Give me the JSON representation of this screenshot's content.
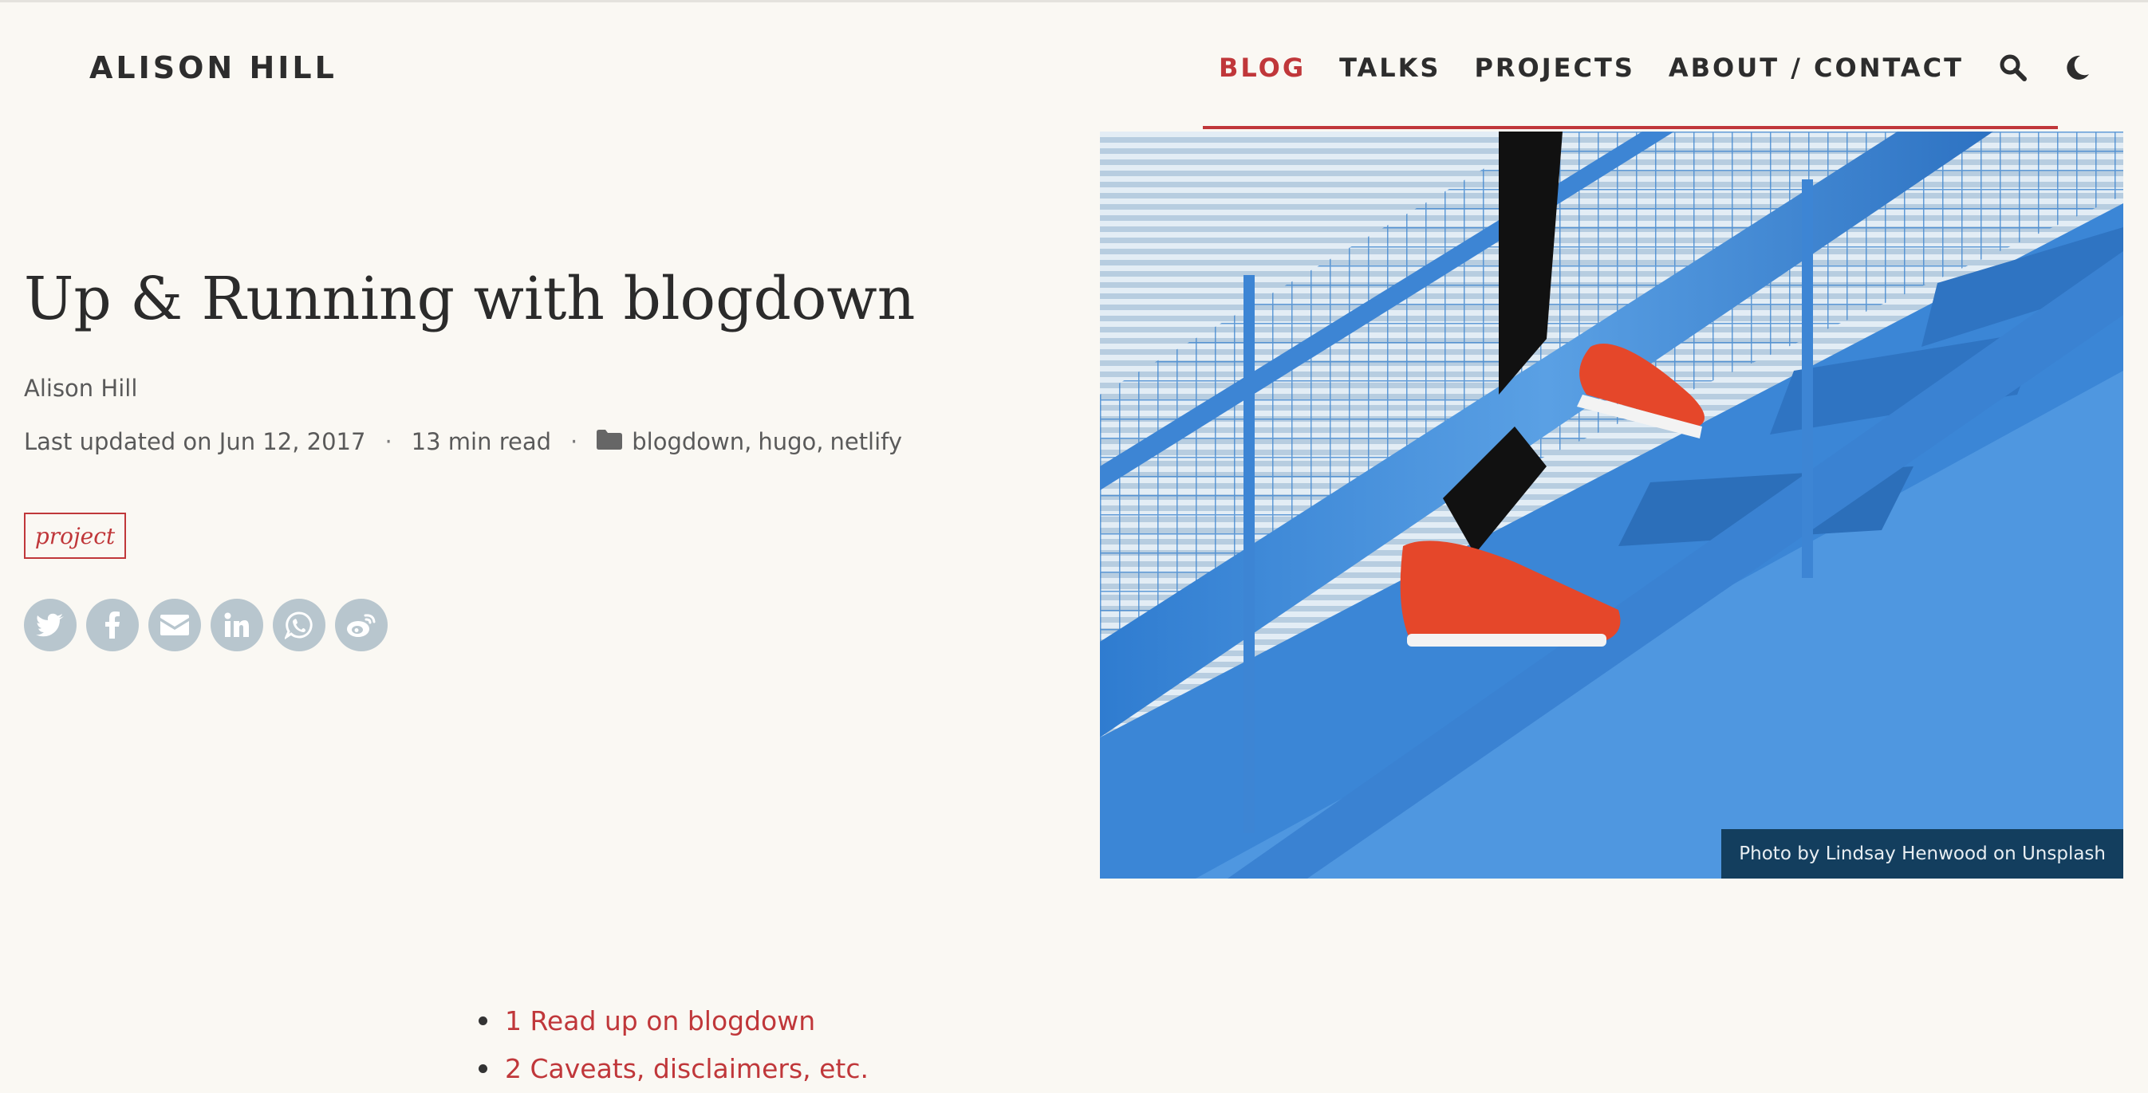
{
  "site": {
    "title": "ALISON HILL"
  },
  "nav": {
    "items": [
      {
        "label": "BLOG",
        "active": true
      },
      {
        "label": "TALKS",
        "active": false
      },
      {
        "label": "PROJECTS",
        "active": false
      },
      {
        "label": "ABOUT / CONTACT",
        "active": false
      }
    ],
    "icons": [
      "search-icon",
      "moon-icon"
    ]
  },
  "post": {
    "title": "Up & Running with blogdown",
    "author": "Alison Hill",
    "updated": "Last updated on Jun 12, 2017",
    "read_time": "13 min read",
    "categories": [
      "blogdown",
      "hugo",
      "netlify"
    ],
    "tag": "project"
  },
  "share": {
    "buttons": [
      "twitter-icon",
      "facebook-icon",
      "email-icon",
      "linkedin-icon",
      "whatsapp-icon",
      "weibo-icon"
    ]
  },
  "hero": {
    "caption": "Photo by Lindsay Henwood on Unsplash"
  },
  "toc": {
    "items": [
      {
        "label": "1 Read up on blogdown"
      },
      {
        "label": "2 Caveats, disclaimers, etc."
      }
    ]
  },
  "colors": {
    "accent": "#c0373a",
    "background": "#faf8f3",
    "text": "#2d2d2d",
    "share_button": "#b8c6ce"
  }
}
